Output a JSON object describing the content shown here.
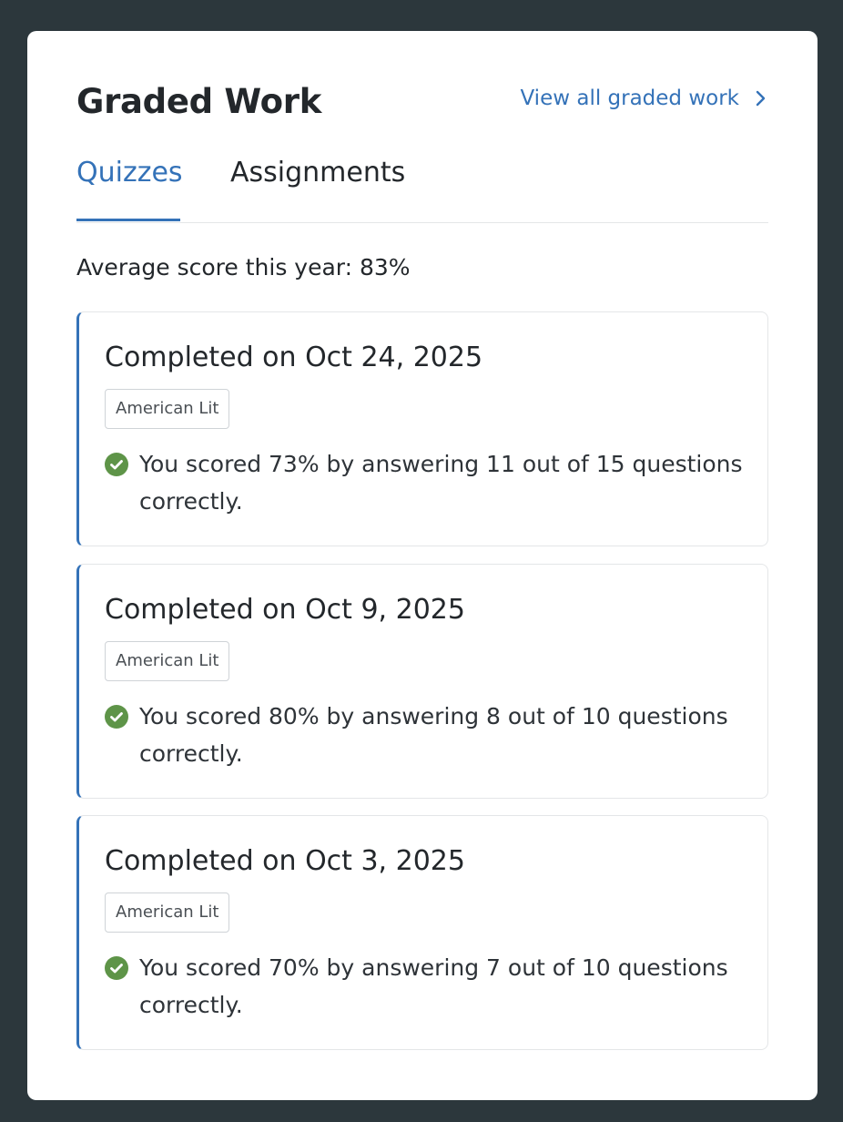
{
  "header": {
    "title": "Graded Work",
    "view_all_label": "View all graded work"
  },
  "tabs": [
    {
      "label": "Quizzes",
      "active": true
    },
    {
      "label": "Assignments",
      "active": false
    }
  ],
  "average": {
    "text": "Average score this year: 83%"
  },
  "cards": [
    {
      "title": "Completed on Oct 24, 2025",
      "tag": "American Lit",
      "result": "You scored 73% by answering 11 out of 15 questions correctly."
    },
    {
      "title": "Completed on Oct 9, 2025",
      "tag": "American Lit",
      "result": "You scored 80% by answering 8 out of 10 questions correctly."
    },
    {
      "title": "Completed on Oct 3, 2025",
      "tag": "American Lit",
      "result": "You scored 70% by answering 7 out of 10 questions correctly."
    }
  ],
  "icons": {
    "view_all": "chevron-right-icon",
    "result": "check-circle-icon"
  },
  "colors": {
    "background": "#2c373c",
    "accent": "#3472b8",
    "success": "#5e9448"
  }
}
